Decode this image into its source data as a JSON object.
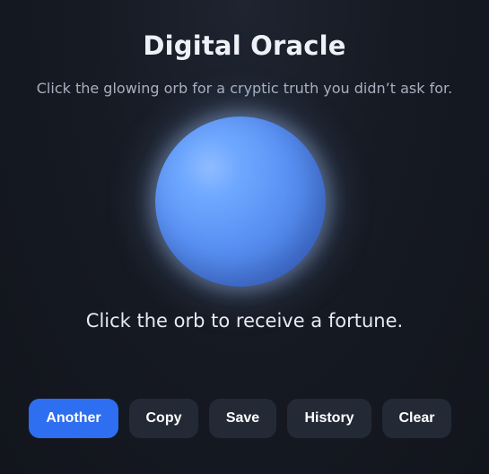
{
  "header": {
    "title": "Digital Oracle",
    "subtitle": "Click the glowing orb for a cryptic truth you didn’t ask for."
  },
  "orb": {
    "icon": "glowing-orb",
    "color": "#5b93f5"
  },
  "fortune": {
    "text": "Click the orb to receive a fortune."
  },
  "actions": {
    "another_label": "Another",
    "copy_label": "Copy",
    "save_label": "Save",
    "history_label": "History",
    "clear_label": "Clear"
  },
  "colors": {
    "primary_button": "#2e6ef0",
    "secondary_button": "#232a36",
    "background": "#161a23"
  }
}
